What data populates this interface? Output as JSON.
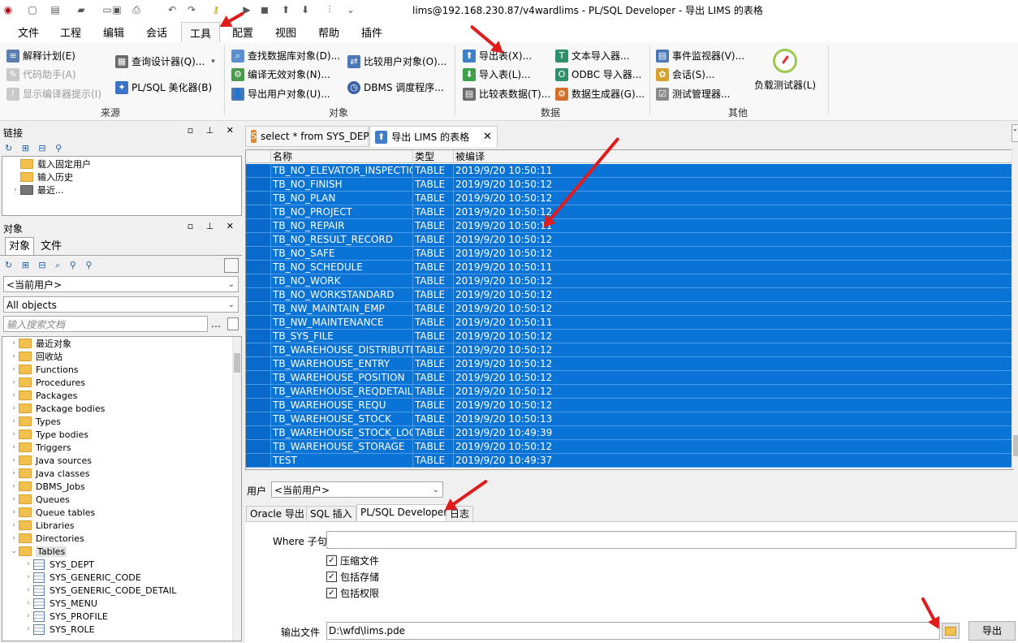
{
  "window": {
    "title": "lims@192.168.230.87/v4wardlims - PL/SQL Developer - 导出 LIMS 的表格"
  },
  "menu": [
    "文件",
    "工程",
    "编辑",
    "会话",
    "工具",
    "配置",
    "视图",
    "帮助",
    "插件"
  ],
  "ribbon": {
    "source": {
      "title": "来源",
      "items": [
        "解释计划(E)",
        "代码助手(A)",
        "显示编译器提示(I)",
        "查询设计器(Q)...",
        "PL/SQL 美化器(B)"
      ]
    },
    "objects": {
      "title": "对象",
      "items": [
        "查找数据库对象(D)...",
        "编译无效对象(N)...",
        "导出用户对象(U)...",
        "比较用户对象(O)...",
        "DBMS 调度程序..."
      ]
    },
    "data": {
      "title": "数据",
      "items": [
        "导出表(X)...",
        "导入表(L)...",
        "比较表数据(T)...",
        "文本导入器...",
        "ODBC 导入器...",
        "数据生成器(G)..."
      ]
    },
    "other": {
      "title": "其他",
      "items": [
        "事件监视器(V)...",
        "会话(S)...",
        "测试管理器...",
        "负载测试器(L)"
      ]
    }
  },
  "connections": {
    "title": "链接",
    "items": [
      "载入固定用户",
      "输入历史",
      "最近..."
    ]
  },
  "objects_panel": {
    "title": "对象",
    "tabs": [
      "对象",
      "文件"
    ],
    "user_combo": "<当前用户>",
    "filter_combo": "All objects",
    "search_placeholder": "输入搜索文档",
    "tree": [
      "最近对象",
      "回收站",
      "Functions",
      "Procedures",
      "Packages",
      "Package bodies",
      "Types",
      "Type bodies",
      "Triggers",
      "Java sources",
      "Java classes",
      "DBMS_Jobs",
      "Queues",
      "Queue tables",
      "Libraries",
      "Directories",
      "Tables"
    ],
    "tables": [
      "SYS_DEPT",
      "SYS_GENERIC_CODE",
      "SYS_GENERIC_CODE_DETAIL",
      "SYS_MENU",
      "SYS_PROFILE",
      "SYS_ROLE"
    ]
  },
  "doc_tabs": [
    "select * from SYS_DEPT",
    "导出 LIMS 的表格"
  ],
  "grid": {
    "columns": [
      "名称",
      "类型",
      "被编译"
    ],
    "rows": [
      [
        "TB_NO_ELEVATOR_INSPECTION",
        "TABLE",
        "2019/9/20 10:50:11"
      ],
      [
        "TB_NO_FINISH",
        "TABLE",
        "2019/9/20 10:50:12"
      ],
      [
        "TB_NO_PLAN",
        "TABLE",
        "2019/9/20 10:50:12"
      ],
      [
        "TB_NO_PROJECT",
        "TABLE",
        "2019/9/20 10:50:12"
      ],
      [
        "TB_NO_REPAIR",
        "TABLE",
        "2019/9/20 10:50:11"
      ],
      [
        "TB_NO_RESULT_RECORD",
        "TABLE",
        "2019/9/20 10:50:12"
      ],
      [
        "TB_NO_SAFE",
        "TABLE",
        "2019/9/20 10:50:12"
      ],
      [
        "TB_NO_SCHEDULE",
        "TABLE",
        "2019/9/20 10:50:11"
      ],
      [
        "TB_NO_WORK",
        "TABLE",
        "2019/9/20 10:50:12"
      ],
      [
        "TB_NO_WORKSTANDARD",
        "TABLE",
        "2019/9/20 10:50:12"
      ],
      [
        "TB_NW_MAINTAIN_EMP",
        "TABLE",
        "2019/9/20 10:50:12"
      ],
      [
        "TB_NW_MAINTENANCE",
        "TABLE",
        "2019/9/20 10:50:11"
      ],
      [
        "TB_SYS_FILE",
        "TABLE",
        "2019/9/20 10:50:12"
      ],
      [
        "TB_WAREHOUSE_DISTRIBUTION",
        "TABLE",
        "2019/9/20 10:50:12"
      ],
      [
        "TB_WAREHOUSE_ENTRY",
        "TABLE",
        "2019/9/20 10:50:12"
      ],
      [
        "TB_WAREHOUSE_POSITION",
        "TABLE",
        "2019/9/20 10:50:12"
      ],
      [
        "TB_WAREHOUSE_REQDETAIL",
        "TABLE",
        "2019/9/20 10:50:12"
      ],
      [
        "TB_WAREHOUSE_REQU",
        "TABLE",
        "2019/9/20 10:50:12"
      ],
      [
        "TB_WAREHOUSE_STOCK",
        "TABLE",
        "2019/9/20 10:50:13"
      ],
      [
        "TB_WAREHOUSE_STOCK_LOG",
        "TABLE",
        "2019/9/20 10:49:39"
      ],
      [
        "TB_WAREHOUSE_STORAGE",
        "TABLE",
        "2019/9/20 10:50:12"
      ],
      [
        "TEST",
        "TABLE",
        "2019/9/20 10:49:37"
      ]
    ]
  },
  "export": {
    "user_label": "用户",
    "user_value": "<当前用户>",
    "tabs": [
      "Oracle 导出",
      "SQL 插入",
      "PL/SQL Developer",
      "日志"
    ],
    "where_label": "Where 子句",
    "where_value": "",
    "options": [
      "压缩文件",
      "包括存储",
      "包括权限"
    ],
    "output_label": "输出文件",
    "output_value": "D:\\wfd\\lims.pde",
    "export_button": "导出"
  },
  "colors": {
    "selection": "#0a74d6",
    "annotation_arrow": "#e01b1b"
  }
}
